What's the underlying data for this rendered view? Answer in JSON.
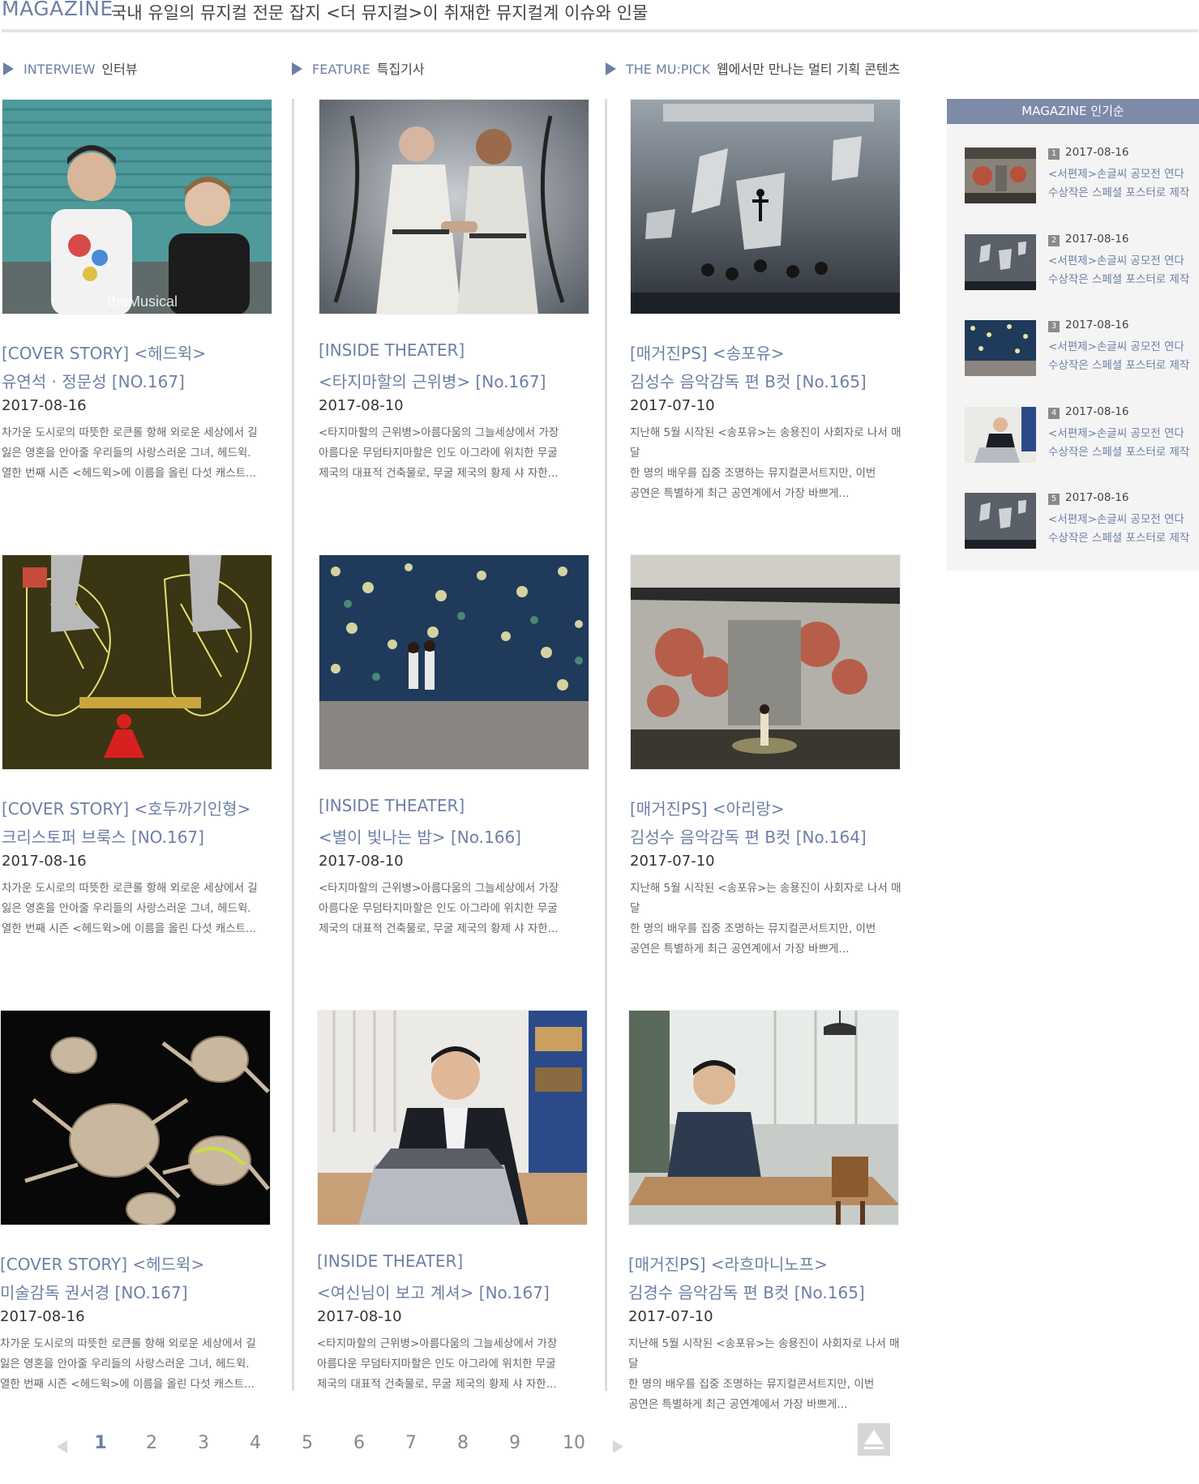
{
  "header": {
    "brand": "MAGAZINE",
    "description": "국내 유일의 뮤지컬 전문 잡지 <더 뮤지컬>이 취재한 뮤지컬계 이슈와 인물"
  },
  "columns": [
    {
      "en": "INTERVIEW",
      "ko": "인터뷰"
    },
    {
      "en": "FEATURE",
      "ko": "특집기사"
    },
    {
      "en": "THE MU:PICK",
      "ko": "웹에서만 만나는 멀티 기획 콘텐츠"
    }
  ],
  "cards": [
    {
      "title1": "[COVER STORY] <헤드윅>",
      "title2": "유연석 · 정문성 [NO.167]",
      "date": "2017-08-16",
      "excerpt": [
        "차가운 도시로의 따뜻한 로큰롤 항해  외로운 세상에서 길",
        "잃은 영혼을 안아줄 우리들의 사랑스러운 그녀, 헤드윅.",
        "열한 번째 시즌 <헤드윅>에 이름을 올린 다섯 캐스트..."
      ],
      "image_label": "theMusical"
    },
    {
      "title1": "[INSIDE THEATER]",
      "title2": "<타지마할의 근위병> [No.167]",
      "date": "2017-08-10",
      "excerpt": [
        "<타지마할의 근위병>아름다움의 그늘세상에서 가장",
        "아름다운 무덤타지마할은 인도 아그라에 위치한 무굴",
        "제국의 대표적 건축물로, 무굴 제국의 황제 샤 자한..."
      ]
    },
    {
      "title1": "[매거진PS] <송포유>",
      "title2": "김성수 음악감독 편 B컷 [No.165]",
      "date": "2017-07-10",
      "excerpt": [
        "지난해 5월 시작된 <송포유>는 송용진이 사회자로 나서 매달",
        "한 명의 배우를 집중 조명하는 뮤지컬콘서트지만, 이번",
        "공연은 특별하게 최근 공연계에서 가장 바쁘게..."
      ]
    },
    {
      "title1": "[COVER STORY] <호두까기인형>",
      "title2": "크리스토퍼 브룩스 [NO.167]",
      "date": "2017-08-16",
      "excerpt": [
        "차가운 도시로의 따뜻한 로큰롤 항해  외로운 세상에서 길",
        "잃은 영혼을 안아줄 우리들의 사랑스러운 그녀, 헤드윅.",
        "열한 번째 시즌 <헤드윅>에 이름을 올린 다섯 캐스트..."
      ]
    },
    {
      "title1": "[INSIDE THEATER]",
      "title2": "<별이 빛나는 밤> [No.166]",
      "date": "2017-08-10",
      "excerpt": [
        "<타지마할의 근위병>아름다움의 그늘세상에서 가장",
        "아름다운 무덤타지마할은 인도 아그라에 위치한 무굴",
        "제국의 대표적 건축물로, 무굴 제국의 황제 샤 자한..."
      ]
    },
    {
      "title1": "[매거진PS] <아리랑>",
      "title2": "김성수 음악감독 편 B컷 [No.164]",
      "date": "2017-07-10",
      "excerpt": [
        "지난해 5월 시작된 <송포유>는 송용진이 사회자로 나서 매달",
        "한 명의 배우를 집중 조명하는 뮤지컬콘서트지만, 이번",
        "공연은 특별하게 최근 공연계에서 가장 바쁘게..."
      ]
    },
    {
      "title1": "[COVER STORY] <헤드윅>",
      "title2": "미술감독 권서경 [NO.167]",
      "date": "2017-08-16",
      "excerpt": [
        "차가운 도시로의 따뜻한 로큰롤 항해  외로운 세상에서 길",
        "잃은 영혼을 안아줄 우리들의 사랑스러운 그녀, 헤드윅.",
        "열한 번째 시즌 <헤드윅>에 이름을 올린 다섯 캐스트..."
      ]
    },
    {
      "title1": "[INSIDE THEATER]",
      "title2": "<여신님이 보고 계셔> [No.167]",
      "date": "2017-08-10",
      "excerpt": [
        "<타지마할의 근위병>아름다움의 그늘세상에서 가장",
        "아름다운 무덤타지마할은 인도 아그라에 위치한 무굴",
        "제국의 대표적 건축물로, 무굴 제국의 황제 샤 자한..."
      ]
    },
    {
      "title1": "[매거진PS] <라흐마니노프>",
      "title2": "김경수 음악감독 편 B컷 [No.165]",
      "date": "2017-07-10",
      "excerpt": [
        "지난해 5월 시작된 <송포유>는 송용진이 사회자로 나서 매달",
        "한 명의 배우를 집중 조명하는 뮤지컬콘서트지만, 이번",
        "공연은 특별하게 최근 공연계에서 가장 바쁘게..."
      ]
    }
  ],
  "popular": {
    "header_en": "MAGAZINE",
    "header_ko": "인기순",
    "items": [
      {
        "rank": "1",
        "date": "2017-08-16",
        "line1": "<서편제>손글씨 공모전 연다",
        "line2": "수상작은 스페셜 포스터로 제작"
      },
      {
        "rank": "2",
        "date": "2017-08-16",
        "line1": "<서편제>손글씨 공모전 연다",
        "line2": "수상작은 스페셜 포스터로 제작"
      },
      {
        "rank": "3",
        "date": "2017-08-16",
        "line1": "<서편제>손글씨 공모전 연다",
        "line2": "수상작은 스페셜 포스터로 제작"
      },
      {
        "rank": "4",
        "date": "2017-08-16",
        "line1": "<서편제>손글씨 공모전 연다",
        "line2": "수상작은 스페셜 포스터로 제작"
      },
      {
        "rank": "5",
        "date": "2017-08-16",
        "line1": "<서편제>손글씨 공모전 연다",
        "line2": "수상작은 스페셜 포스터로 제작"
      }
    ]
  },
  "pagination": {
    "pages": [
      "1",
      "2",
      "3",
      "4",
      "5",
      "6",
      "7",
      "8",
      "9",
      "10"
    ],
    "current": "1"
  },
  "colors": {
    "accent": "#6e7fa6",
    "popular_header": "#7d8aa8",
    "panel_bg": "#f4f4f4",
    "divider": "#dcdcdc"
  },
  "icons": {
    "prev": "triangle-left-icon",
    "next": "triangle-right-icon",
    "to_top": "arrow-up-icon",
    "section": "triangle-right-icon"
  }
}
